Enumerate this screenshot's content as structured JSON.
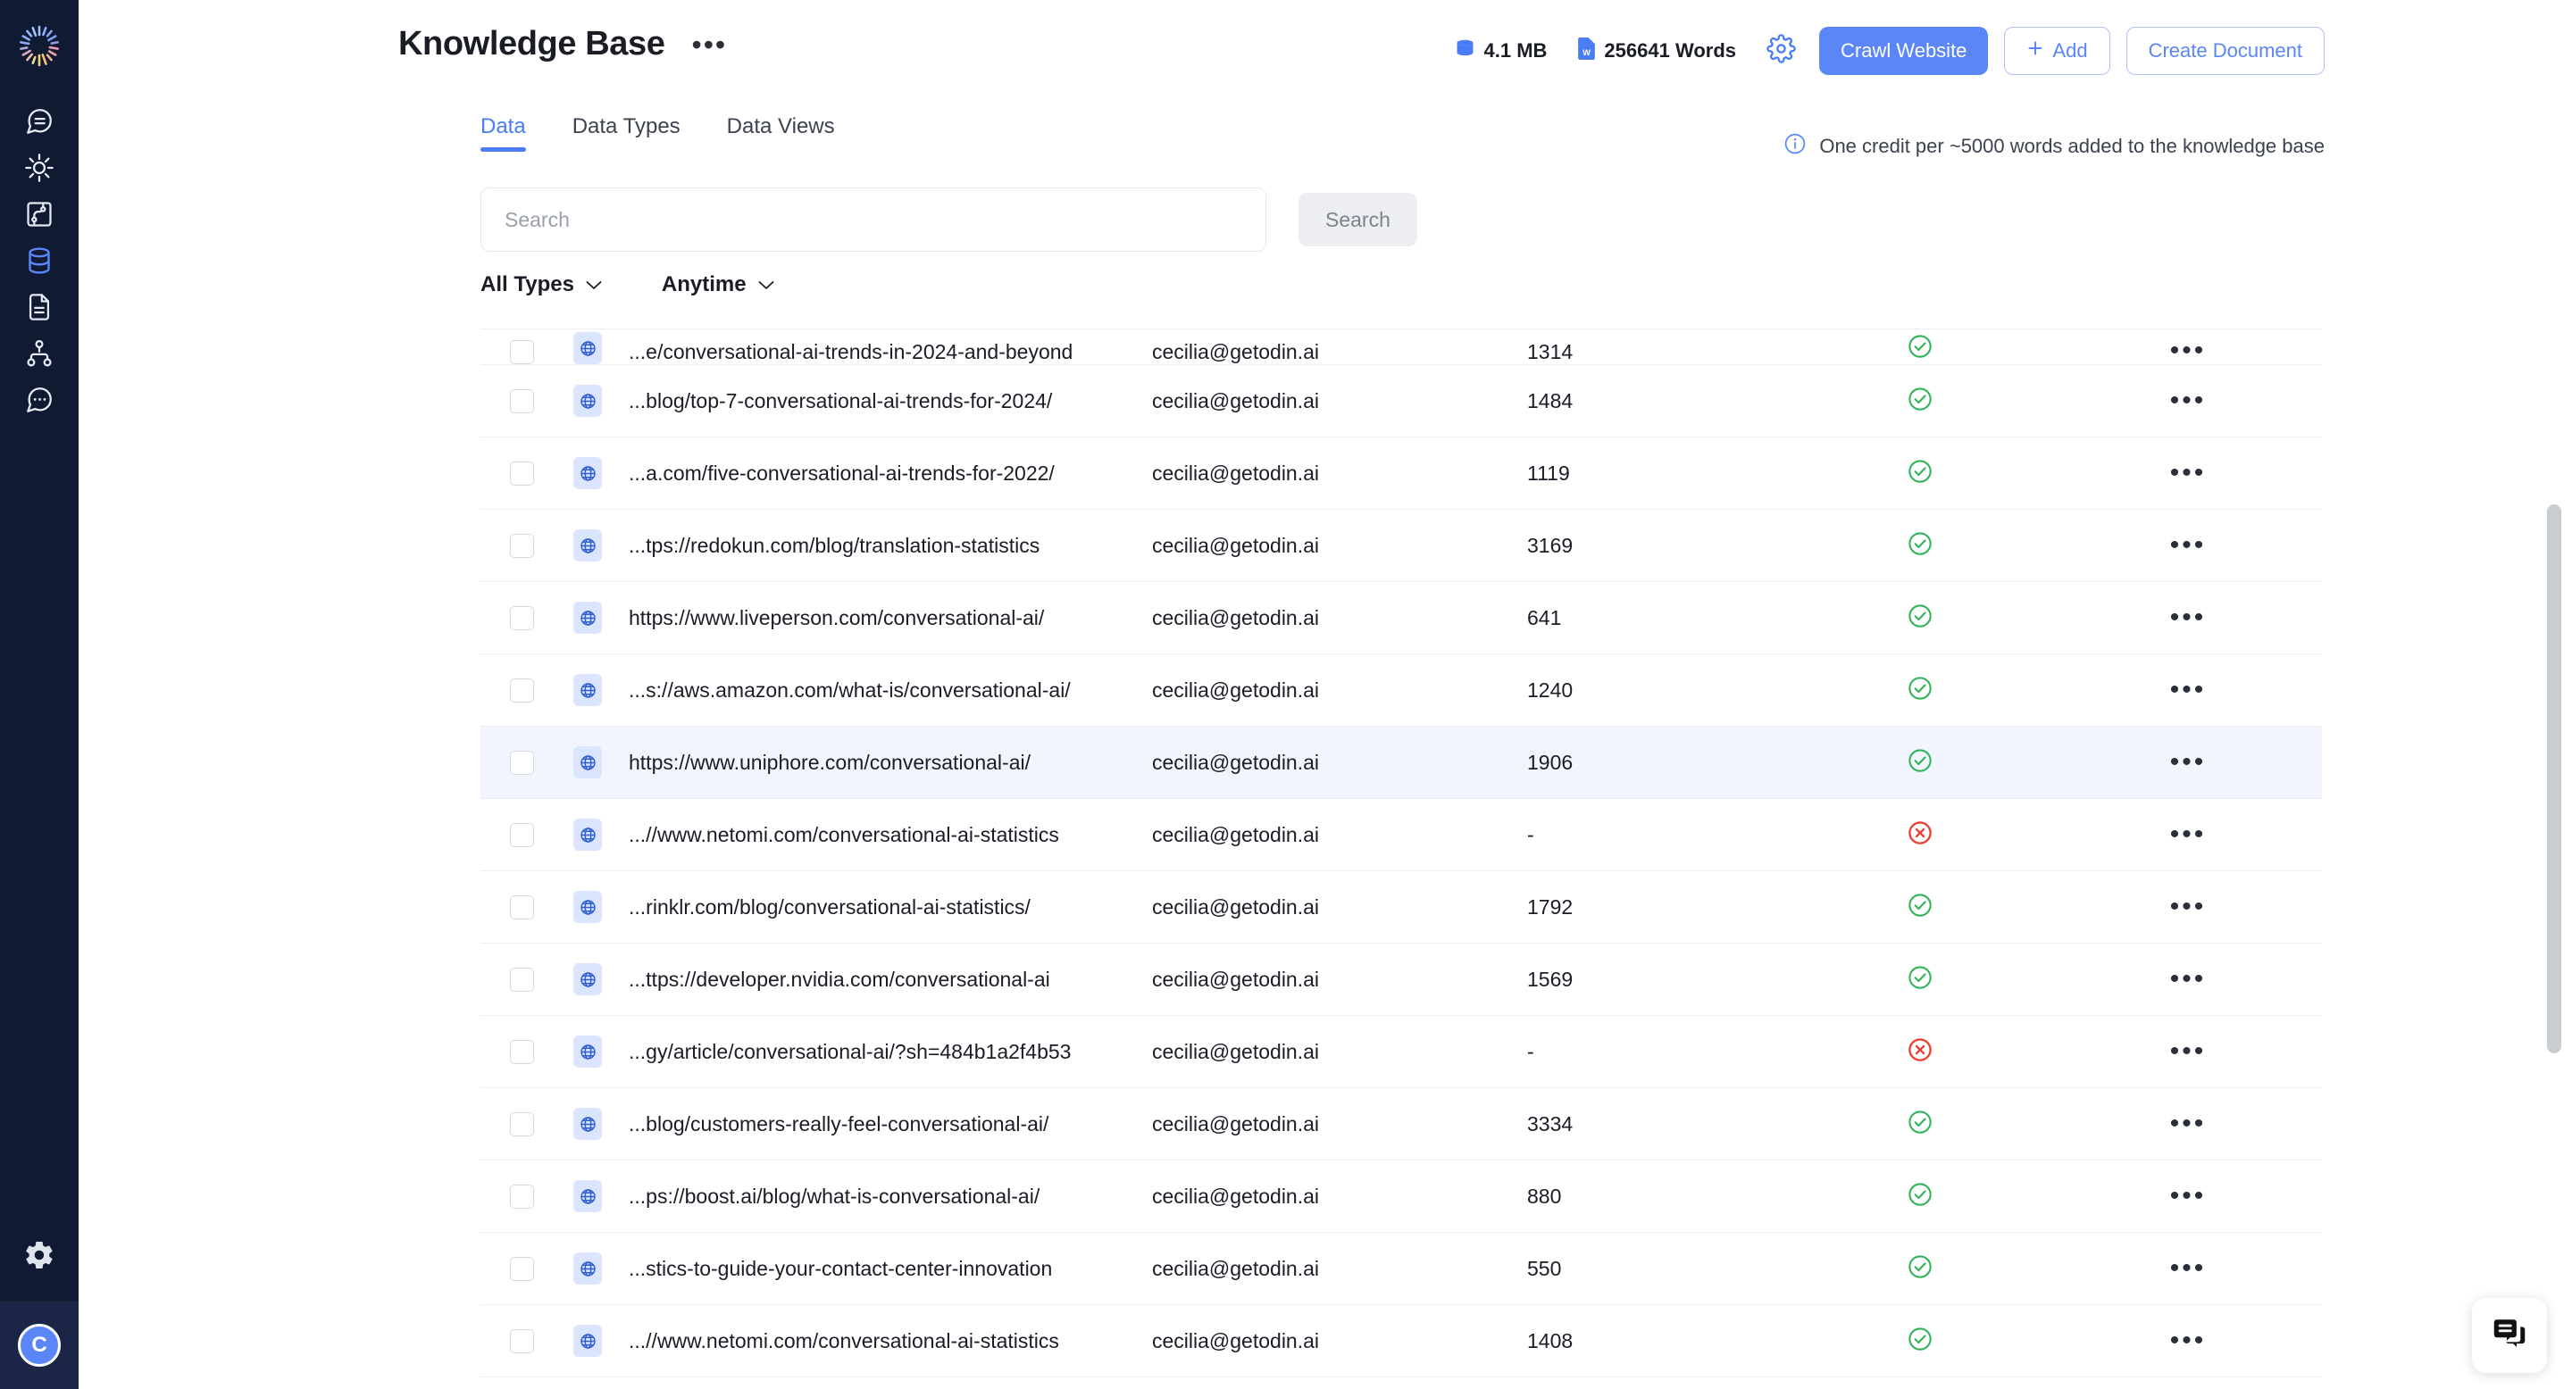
{
  "sidebar": {
    "logo_name": "app-logo",
    "items": [
      {
        "name": "sidebar-item-conversations",
        "icon": "chat-lines-icon",
        "active": false
      },
      {
        "name": "sidebar-item-automation",
        "icon": "sun-gear-icon",
        "active": false
      },
      {
        "name": "sidebar-item-workflows",
        "icon": "flow-map-icon",
        "active": false
      },
      {
        "name": "sidebar-item-knowledge-base",
        "icon": "database-icon",
        "active": true
      },
      {
        "name": "sidebar-item-documents",
        "icon": "document-icon",
        "active": false
      },
      {
        "name": "sidebar-item-org",
        "icon": "hierarchy-icon",
        "active": false
      },
      {
        "name": "sidebar-item-chat",
        "icon": "chat-dots-icon",
        "active": false
      }
    ],
    "settings_icon": "gear-icon",
    "avatar_initial": "C"
  },
  "header": {
    "title": "Knowledge Base",
    "more_label": "•••",
    "size_stat": "4.1 MB",
    "words_stat": "256641 Words",
    "size_icon": "database-disk-icon",
    "words_icon": "word-document-icon",
    "settings_icon": "gear-icon",
    "crawl_label": "Crawl Website",
    "add_label": "Add",
    "add_icon": "plus-icon",
    "create_document_label": "Create Document"
  },
  "tabs": [
    {
      "label": "Data",
      "active": true
    },
    {
      "label": "Data Types",
      "active": false
    },
    {
      "label": "Data Views",
      "active": false
    }
  ],
  "credit_note": {
    "icon": "info-icon",
    "text": "One credit per ~5000 words added to the knowledge base"
  },
  "search": {
    "placeholder": "Search",
    "value": "",
    "button_label": "Search"
  },
  "filters": [
    {
      "label": "All Types",
      "name": "filter-all-types"
    },
    {
      "label": "Anytime",
      "name": "filter-anytime"
    }
  ],
  "table": {
    "row_icon": "globe-icon",
    "actions_label": "•••",
    "status_ok_icon": "check-circle-icon",
    "status_error_icon": "x-circle-icon",
    "rows": [
      {
        "url": "...e/conversational-ai-trends-in-2024-and-beyond",
        "owner": "cecilia@getodin.ai",
        "words": "1314",
        "status": "ok",
        "highlight": false,
        "clipped": true
      },
      {
        "url": "...blog/top-7-conversational-ai-trends-for-2024/",
        "owner": "cecilia@getodin.ai",
        "words": "1484",
        "status": "ok",
        "highlight": false,
        "clipped": false
      },
      {
        "url": "...a.com/five-conversational-ai-trends-for-2022/",
        "owner": "cecilia@getodin.ai",
        "words": "1119",
        "status": "ok",
        "highlight": false,
        "clipped": false
      },
      {
        "url": "...tps://redokun.com/blog/translation-statistics",
        "owner": "cecilia@getodin.ai",
        "words": "3169",
        "status": "ok",
        "highlight": false,
        "clipped": false
      },
      {
        "url": "https://www.liveperson.com/conversational-ai/",
        "owner": "cecilia@getodin.ai",
        "words": "641",
        "status": "ok",
        "highlight": false,
        "clipped": false
      },
      {
        "url": "...s://aws.amazon.com/what-is/conversational-ai/",
        "owner": "cecilia@getodin.ai",
        "words": "1240",
        "status": "ok",
        "highlight": false,
        "clipped": false
      },
      {
        "url": "https://www.uniphore.com/conversational-ai/",
        "owner": "cecilia@getodin.ai",
        "words": "1906",
        "status": "ok",
        "highlight": true,
        "clipped": false
      },
      {
        "url": "...//www.netomi.com/conversational-ai-statistics",
        "owner": "cecilia@getodin.ai",
        "words": "-",
        "status": "error",
        "highlight": false,
        "clipped": false
      },
      {
        "url": "...rinklr.com/blog/conversational-ai-statistics/",
        "owner": "cecilia@getodin.ai",
        "words": "1792",
        "status": "ok",
        "highlight": false,
        "clipped": false
      },
      {
        "url": "...ttps://developer.nvidia.com/conversational-ai",
        "owner": "cecilia@getodin.ai",
        "words": "1569",
        "status": "ok",
        "highlight": false,
        "clipped": false
      },
      {
        "url": "...gy/article/conversational-ai/?sh=484b1a2f4b53",
        "owner": "cecilia@getodin.ai",
        "words": "-",
        "status": "error",
        "highlight": false,
        "clipped": false
      },
      {
        "url": "...blog/customers-really-feel-conversational-ai/",
        "owner": "cecilia@getodin.ai",
        "words": "3334",
        "status": "ok",
        "highlight": false,
        "clipped": false
      },
      {
        "url": "...ps://boost.ai/blog/what-is-conversational-ai/",
        "owner": "cecilia@getodin.ai",
        "words": "880",
        "status": "ok",
        "highlight": false,
        "clipped": false
      },
      {
        "url": "...stics-to-guide-your-contact-center-innovation",
        "owner": "cecilia@getodin.ai",
        "words": "550",
        "status": "ok",
        "highlight": false,
        "clipped": false
      },
      {
        "url": "...//www.netomi.com/conversational-ai-statistics",
        "owner": "cecilia@getodin.ai",
        "words": "1408",
        "status": "ok",
        "highlight": false,
        "clipped": false
      }
    ]
  },
  "chat_widget": {
    "icon": "chat-bubbles-icon"
  },
  "colors": {
    "accent": "#5b86f7",
    "sidebar_bg": "#111a33",
    "success": "#34b45a",
    "error": "#ea4335",
    "row_highlight": "#f2f5fe"
  }
}
